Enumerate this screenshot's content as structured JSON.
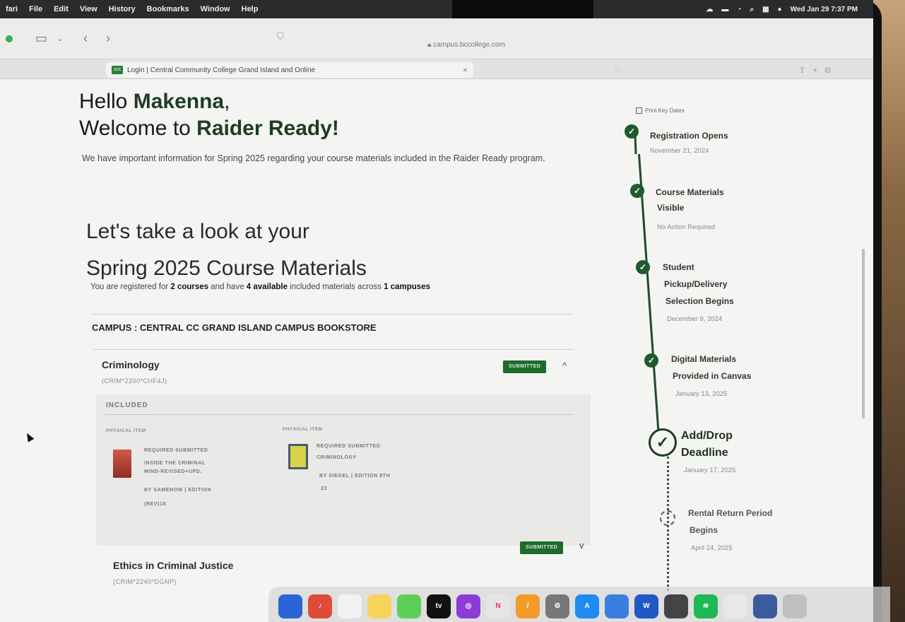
{
  "menubar": {
    "items": [
      "fari",
      "File",
      "Edit",
      "View",
      "History",
      "Bookmarks",
      "Window",
      "Help"
    ],
    "clock": "Wed Jan 29 7:37 PM"
  },
  "browser": {
    "url": "campus.bccollege.com",
    "tab_title": "Login | Central Community College Grand Island and Online",
    "favicon_text": "ccc"
  },
  "greeting": {
    "hello_prefix": "Hello ",
    "name": "Makenna",
    "hello_suffix": ",",
    "welcome_prefix": "Welcome to ",
    "program": "Raider Ready!",
    "intro": "We have important information for Spring 2025 regarding your course materials included in the Raider Ready program."
  },
  "materials": {
    "heading_line1": "Let's take a look at your",
    "heading_line2": "Spring 2025 Course Materials",
    "reg_prefix": "You are registered for ",
    "reg_courses": "2 courses",
    "reg_mid": " and have ",
    "reg_available": "4 available",
    "reg_mid2": " included materials across ",
    "reg_campuses": "1 campuses"
  },
  "campus_label": "CAMPUS : CENTRAL CC GRAND ISLAND CAMPUS BOOKSTORE",
  "courses": [
    {
      "name": "Criminology",
      "code": "(CRIM*2200*CHF4J)",
      "status": "SUBMITTED",
      "chevron": "^",
      "included_label": "INCLUDED",
      "items": [
        {
          "type": "PHYSICAL ITEM",
          "status_line": "REQUIRED  SUBMITTED",
          "title_line1": "INSIDE THE CRIMINAL",
          "title_line2": "MIND-REVISED+UPD.",
          "author_line": "BY SAMENOW  |  EDITION",
          "edition": "(REV)18"
        },
        {
          "type": "PHYSICAL ITEM",
          "status_line": "REQUIRED  SUBMITTED",
          "title_line1": "CRIMINOLOGY",
          "author_line": "BY SIEGEL  |  EDITION  8TH",
          "edition": "23"
        }
      ]
    },
    {
      "name": "Ethics in Criminal Justice",
      "code": "(CRIM*2240*DGNP)",
      "status": "SUBMITTED",
      "chevron": "v"
    }
  ],
  "timeline": {
    "header": "Print Key Dates",
    "events": [
      {
        "title_lines": [
          "Registration Opens"
        ],
        "date": "November 21, 2024",
        "state": "done"
      },
      {
        "title_lines": [
          "Course Materials",
          "Visible"
        ],
        "date": "No Action Required",
        "state": "done"
      },
      {
        "title_lines": [
          "Student",
          "Pickup/Delivery",
          "Selection Begins"
        ],
        "date": "December 9, 2024",
        "state": "done"
      },
      {
        "title_lines": [
          "Digital Materials",
          "Provided in Canvas"
        ],
        "date": "January 13, 2025",
        "state": "done"
      },
      {
        "title_lines": [
          "Add/Drop",
          "Deadline"
        ],
        "date": "January 17, 2025",
        "state": "current"
      },
      {
        "title_lines": [
          "Rental Return Period",
          "Begins"
        ],
        "date": "April 24, 2025",
        "state": "upcoming"
      }
    ]
  },
  "colors": {
    "brand_green": "#1f5a2c",
    "badge_green": "#1f6b2a",
    "text_dark": "#1a1a1a"
  }
}
